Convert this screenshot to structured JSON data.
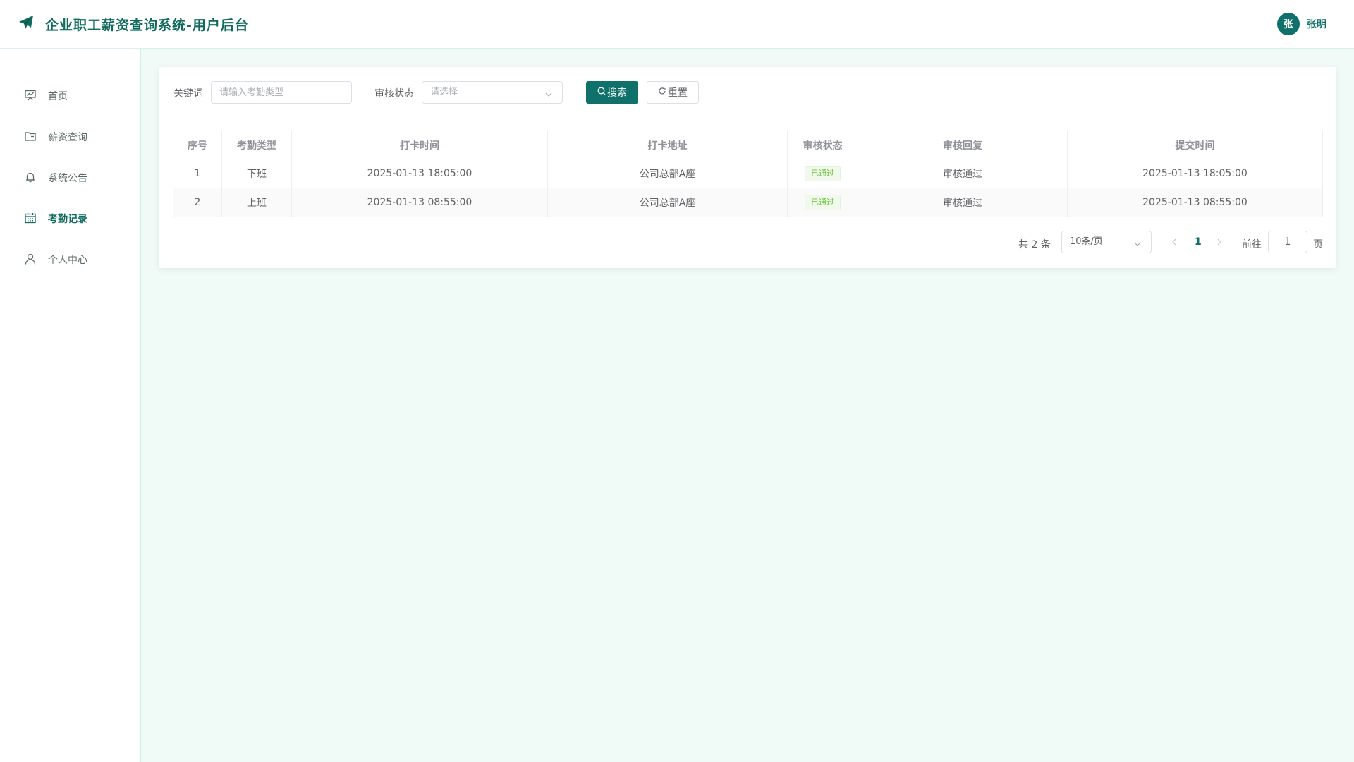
{
  "header": {
    "title": "企业职工薪资查询系统-用户后台",
    "avatar_text": "张",
    "user_name": "张明"
  },
  "sidebar": {
    "items": [
      {
        "label": "首页",
        "icon": "chart-board-icon",
        "active": false
      },
      {
        "label": "薪资查询",
        "icon": "folder-icon",
        "active": false
      },
      {
        "label": "系统公告",
        "icon": "bell-icon",
        "active": false
      },
      {
        "label": "考勤记录",
        "icon": "calendar-icon",
        "active": true
      },
      {
        "label": "个人中心",
        "icon": "user-icon",
        "active": false
      }
    ]
  },
  "filter": {
    "keyword_label": "关键词",
    "keyword_placeholder": "请输入考勤类型",
    "status_label": "审核状态",
    "status_placeholder": "请选择",
    "search_label": "搜索",
    "reset_label": "重置"
  },
  "table": {
    "columns": [
      "序号",
      "考勤类型",
      "打卡时间",
      "打卡地址",
      "审核状态",
      "审核回复",
      "提交时间"
    ],
    "rows": [
      {
        "index": "1",
        "type": "下班",
        "punch_time": "2025-01-13 18:05:00",
        "address": "公司总部A座",
        "status": "已通过",
        "reply": "审核通过",
        "submit_time": "2025-01-13 18:05:00"
      },
      {
        "index": "2",
        "type": "上班",
        "punch_time": "2025-01-13 08:55:00",
        "address": "公司总部A座",
        "status": "已通过",
        "reply": "审核通过",
        "submit_time": "2025-01-13 08:55:00"
      }
    ]
  },
  "pagination": {
    "total_text": "共 2 条",
    "page_size": "10条/页",
    "current_page": "1",
    "goto_label": "前往",
    "goto_value": "1",
    "page_suffix": "页"
  },
  "colors": {
    "primary": "#10706a",
    "success": "#67c23a",
    "background": "#f0fbf8"
  }
}
